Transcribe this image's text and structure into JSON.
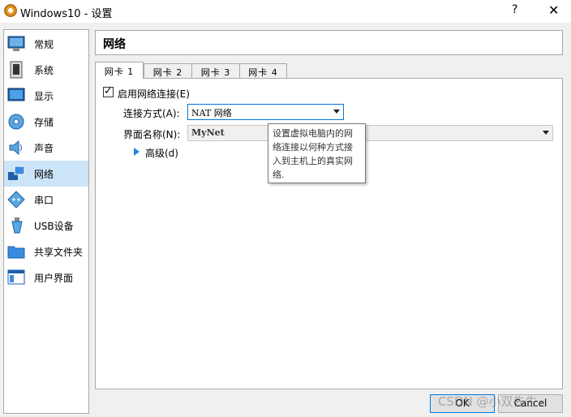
{
  "window": {
    "title": "Windows10 - 设置",
    "help_label": "?",
    "close_label": "✕"
  },
  "sidebar": {
    "items": [
      {
        "label": "常规",
        "icon": "general-icon"
      },
      {
        "label": "系统",
        "icon": "system-icon"
      },
      {
        "label": "显示",
        "icon": "display-icon"
      },
      {
        "label": "存储",
        "icon": "storage-icon"
      },
      {
        "label": "声音",
        "icon": "audio-icon"
      },
      {
        "label": "网络",
        "icon": "network-icon",
        "selected": true
      },
      {
        "label": "串口",
        "icon": "serial-port-icon"
      },
      {
        "label": "USB设备",
        "icon": "usb-icon"
      },
      {
        "label": "共享文件夹",
        "icon": "shared-folder-icon"
      },
      {
        "label": "用户界面",
        "icon": "user-interface-icon"
      }
    ]
  },
  "header": {
    "title": "网络"
  },
  "tabs": [
    {
      "label": "网卡 1",
      "active": true
    },
    {
      "label": "网卡 2"
    },
    {
      "label": "网卡 3"
    },
    {
      "label": "网卡 4"
    }
  ],
  "adapter": {
    "enable_label": "启用网络连接(E)",
    "enable_checked": true,
    "attached_label": "连接方式(A):",
    "attached_value": "NAT 网络",
    "name_label": "界面名称(N):",
    "name_value": "MyNet",
    "advanced_label": "高级(d)"
  },
  "tooltip": {
    "text": "设置虚拟电脑内的网络连接以何种方式接入到主机上的真实网络."
  },
  "buttons": {
    "ok": "OK",
    "cancel": "Cancel"
  },
  "watermark": "CSDN @小双先生"
}
